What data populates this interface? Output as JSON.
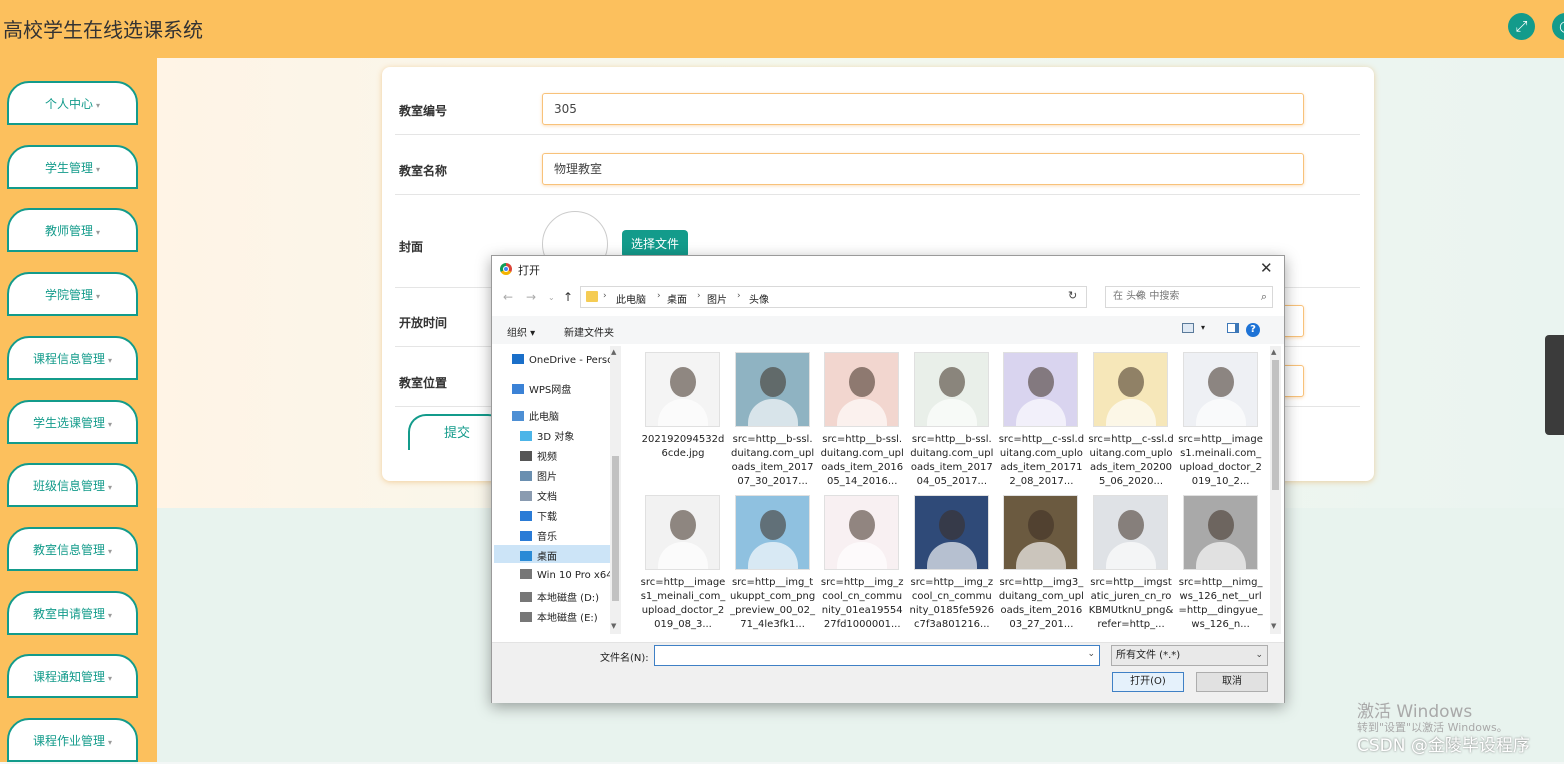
{
  "app": {
    "title": "高校学生在线选课系统"
  },
  "topbar": {
    "icons": [
      "fullscreen-icon",
      "user-icon"
    ]
  },
  "sidebar": {
    "items": [
      {
        "label": "个人中心"
      },
      {
        "label": "学生管理"
      },
      {
        "label": "教师管理"
      },
      {
        "label": "学院管理"
      },
      {
        "label": "课程信息管理"
      },
      {
        "label": "学生选课管理"
      },
      {
        "label": "班级信息管理"
      },
      {
        "label": "教室信息管理"
      },
      {
        "label": "教室申请管理"
      },
      {
        "label": "课程通知管理"
      },
      {
        "label": "课程作业管理"
      }
    ],
    "caret": "▾"
  },
  "form": {
    "classroom_no": {
      "label": "教室编号",
      "value": "305"
    },
    "classroom_name": {
      "label": "教室名称",
      "value": "物理教室"
    },
    "cover": {
      "label": "封面",
      "button": "选择文件"
    },
    "open_time": {
      "label": "开放时间"
    },
    "location": {
      "label": "教室位置"
    },
    "submit": "提交"
  },
  "dialog": {
    "title": "打开",
    "close": "✕",
    "breadcrumb": [
      "此电脑",
      "桌面",
      "图片",
      "头像"
    ],
    "search_placeholder": "在 头像 中搜索",
    "toolbar": {
      "organize": "组织 ▾",
      "new_folder": "新建文件夹",
      "help": "?"
    },
    "nav": [
      {
        "label": "OneDrive - Perso",
        "icon": "onedrive-icon"
      },
      {
        "label": "WPS网盘",
        "icon": "cloud-icon"
      },
      {
        "label": "此电脑",
        "icon": "pc-icon"
      },
      {
        "label": "3D 对象",
        "icon": "3d-icon"
      },
      {
        "label": "视频",
        "icon": "video-icon"
      },
      {
        "label": "图片",
        "icon": "picture-icon"
      },
      {
        "label": "文档",
        "icon": "document-icon"
      },
      {
        "label": "下载",
        "icon": "download-icon"
      },
      {
        "label": "音乐",
        "icon": "music-icon"
      },
      {
        "label": "桌面",
        "icon": "desktop-icon",
        "selected": true
      },
      {
        "label": "Win 10 Pro x64",
        "icon": "drive-icon"
      },
      {
        "label": "本地磁盘 (D:)",
        "icon": "drive-icon"
      },
      {
        "label": "本地磁盘 (E:)",
        "icon": "drive-icon"
      }
    ],
    "files": [
      "202192094532d6cde.jpg",
      "src=http__b-ssl.duitang.com_uploads_item_201707_30_2017...",
      "src=http__b-ssl.duitang.com_uploads_item_201605_14_2016...",
      "src=http__b-ssl.duitang.com_uploads_item_201704_05_2017...",
      "src=http__c-ssl.duitang.com_uploads_item_201712_08_2017...",
      "src=http__c-ssl.duitang.com_uploads_item_202005_06_2020...",
      "src=http__images1.meinali.com_upload_doctor_2019_10_2...",
      "src=http__images1_meinali_com_upload_doctor_2019_08_3...",
      "src=http__img_tukuppt_com_png_preview_00_02_71_4le3fk1...",
      "src=http__img_zcool_cn_community_01ea1955427fd1000001...",
      "src=http__img_zcool_cn_community_0185fe5926c7f3a801216...",
      "src=http__img3_duitang_com_uploads_item_201603_27_201...",
      "src=http__imgstatic_juren_cn_roKBMUtknU_png&refer=http_...",
      "src=http__nimg_ws_126_net__url=http__dingyue_ws_126_n..."
    ],
    "filename_label": "文件名(N):",
    "filename_value": "",
    "filetype": "所有文件 (*.*)",
    "open_button": "打开(O)",
    "cancel_button": "取消"
  },
  "watermark": {
    "line1": "激活 Windows",
    "line2": "转到\"设置\"以激活 Windows。",
    "csdn": "CSDN @金陵毕设程序"
  }
}
